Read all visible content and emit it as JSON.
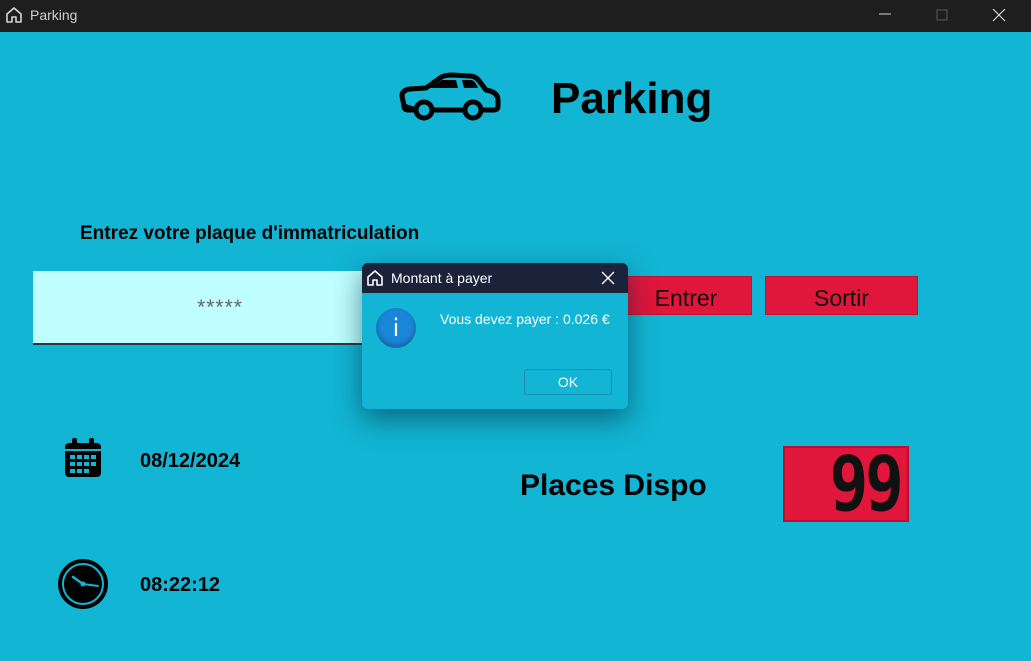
{
  "window": {
    "title": "Parking"
  },
  "app": {
    "heading": "Parking",
    "prompt": "Entrez votre plaque d'immatriculation",
    "plate_placeholder": "*****",
    "enter_label": "Entrer",
    "exit_label": "Sortir",
    "date": "08/12/2024",
    "time": "08:22:12",
    "places_label": "Places Dispo",
    "places_count": "99"
  },
  "dialog": {
    "title": "Montant à payer",
    "message": "Vous devez payer : 0.026 €",
    "ok_label": "OK",
    "icon_glyph": "i"
  },
  "colors": {
    "background": "#12b5d3",
    "titlebar": "#1e1e1e",
    "button": "#e0163a",
    "input": "#bfffff",
    "dialog_titlebar": "#1c2239",
    "info_icon": "#1a86d8"
  }
}
